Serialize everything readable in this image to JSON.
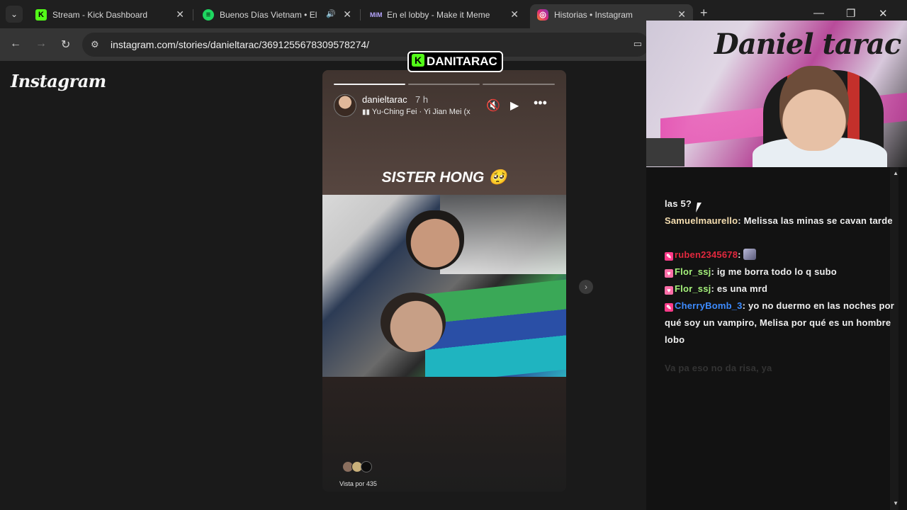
{
  "browser": {
    "tabs": [
      {
        "title": "Stream - Kick Dashboard",
        "favicon": "kick-icon",
        "favicon_color": "#53fc18"
      },
      {
        "title": "Buenos Días Vietnam • El A",
        "favicon": "spotify-icon",
        "favicon_color": "#1ed760"
      },
      {
        "title": "En el lobby - Make it Meme",
        "favicon": "mim-icon",
        "favicon_color": "#7a5cff"
      },
      {
        "title": "Historias • Instagram",
        "favicon": "instagram-icon",
        "favicon_color": "#e1306c"
      }
    ],
    "url": "instagram.com/stories/danieltarac/3691255678309578274/"
  },
  "instagram": {
    "logo": "Instagram",
    "story": {
      "username": "danieltarac",
      "time_ago": "7 h",
      "music": "Yu-Ching Fei · Yi Jian Mei (x",
      "caption": "SISTER HONG 🥺",
      "views_label": "Vista por 435",
      "progress": [
        1,
        0,
        0
      ]
    }
  },
  "overlay": {
    "kick_badge": "DANITARAC",
    "brand_color": "#53fc18"
  },
  "webcam": {
    "wall_graffiti": "Daniel tarac"
  },
  "chat": {
    "lines": [
      {
        "text": "las 5?"
      },
      {
        "user": "Samuelmaurello",
        "user_color": "#f5deb0",
        "text": "Melissa las minas se cavan tarde"
      },
      {
        "user": "ruben2345678",
        "user_color": "#e2283e",
        "text": "",
        "badge": "sub"
      },
      {
        "user": "Flor_ssj",
        "user_color": "#a4f07a",
        "text": "ig me borra todo lo q subo",
        "badge": "heart"
      },
      {
        "user": "Flor_ssj",
        "user_color": "#a4f07a",
        "text": "es una mrd",
        "badge": "heart"
      },
      {
        "user": "CherryBomb_3",
        "user_color": "#3d8bff",
        "text": "yo no duermo en las noches por qué soy un vampiro, Melisa por qué es un hombre lobo",
        "badge": "sub"
      },
      {
        "user": "",
        "text": "Va pa eso no da risa, ya",
        "faded": true
      }
    ]
  }
}
